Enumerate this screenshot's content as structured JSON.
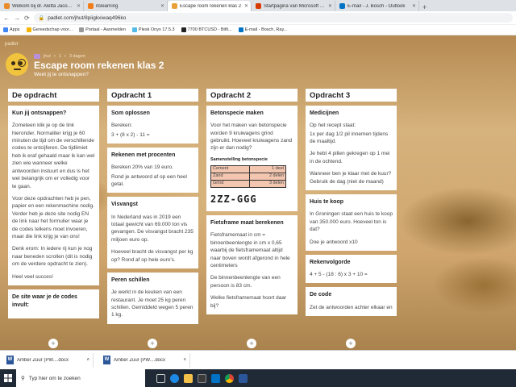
{
  "browser": {
    "tabs": [
      {
        "title": "Welkom bij dr. Aletta Jacobs Coll",
        "color": "#e98b2a"
      },
      {
        "title": "itslearning",
        "color": "#f27d1b"
      },
      {
        "title": "Escape room rekenen klas 2",
        "color": "#e8a13a",
        "active": true
      },
      {
        "title": "Startpagina van Microsoft Office",
        "color": "#d83b01"
      },
      {
        "title": "E-mail - J. Bosch - Outlook",
        "color": "#0072c6"
      }
    ],
    "new_tab": "+",
    "url": "padlet.com/jhut/8piigkxiwaq496ko",
    "bookmarks": [
      "Apps",
      "Gereedschap voor...",
      "Portaal - Aanmelden",
      "Plesk Onyx 17.5.3",
      "7700 BTCUSD - Bitfi...",
      "E-mail - Bosch, Ray..."
    ]
  },
  "padlet": {
    "brand": "padlet",
    "meta": {
      "author": "jhut",
      "likes": "1",
      "age": "3 dagen"
    },
    "title": "Escape room rekenen klas 2",
    "subtitle": "Weet jij te ontsnappen?",
    "add_symbol": "+"
  },
  "columns": [
    {
      "title": "De opdracht",
      "cards": [
        {
          "title": "Kun jij ontsnappen?",
          "paras": [
            "Zometeen klik je op de link hieronder. Normaliter krijg je 60 minuten de tijd om de verschillende codes te ontcijferen. De tijdlimiet heb ik eraf gehaald maar ik kan wel zien wie wanneer welke antwoorden instuurt en dus is het wel belangrijk om er volledig voor te gaan.",
            "Voor deze opdrachten heb je pen, papier en een rekenmachine nodig. Verder heb je deze site nodig EN de link naar het formulier waar je de codes telkens moet invoeren, maar die link krijg je van ons!",
            "Denk erom: In iedere rij kun je nog naar beneden scrollen (dit is nodig om de verdere opdracht te zien).",
            "Heel veel succes!"
          ]
        },
        {
          "title": "De site waar je de codes invult:",
          "paras": []
        }
      ]
    },
    {
      "title": "Opdracht 1",
      "cards": [
        {
          "title": "Som oplossen",
          "paras": [
            "Bereken:",
            "3 + (8 x 2) - 11 ="
          ]
        },
        {
          "title": "Rekenen met procenten",
          "paras": [
            "Bereken 20% van 19 euro.",
            "Rond je antwoord af op een heel getal."
          ]
        },
        {
          "title": "Visvangst",
          "paras": [
            "In Nederland was in 2019 een totaal gewicht van 69.000 ton vis gevangen. De visvangst bracht 235 miljoen euro op.",
            "Hoeveel bracht de visvangst per kg op? Rond af op hele euro's."
          ]
        },
        {
          "title": "Peren schillen",
          "paras": [
            "Je werkt in de keuken van een restaurant. Je moet 25 kg peren schillen. Gemiddeld wegen 5 peren 1 kg."
          ]
        }
      ]
    },
    {
      "title": "Opdracht 2",
      "cards": [
        {
          "title": "Betonspecie maken",
          "paras": [
            "Voor het maken van betonspecie worden 9 kruiwagens grind gebruikt. Hoeveel kruiwagens zand zijn er dan nodig?"
          ],
          "table": {
            "title": "Samenstelling betonspecie",
            "rows": [
              [
                "Cement",
                "1 deel"
              ],
              [
                "Zand",
                "2 delen"
              ],
              [
                "Grind",
                "3 delen"
              ]
            ]
          },
          "figure": "2ZZ-GGG"
        },
        {
          "title": "Fietsframe maat berekenen",
          "paras": [
            "Fietsframemaat in cm = binnenbeenlengte in cm x 0,65 waarbij de fietsframemaat altijd naar boven wordt afgerond in hele centimeters",
            "De binnenbeenlengte van een persoon is 83 cm.",
            "Welke fietsframemaat hoort daar bij?"
          ]
        }
      ]
    },
    {
      "title": "Opdracht 3",
      "cards": [
        {
          "title": "Medicijnen",
          "paras": [
            "Op het recept staat:",
            "1x per dag 1/2 pil innemen tijdens de maaltijd.",
            "Je hebt 4 pillen gekregen op 1 mei in de ochtend.",
            "Wanneer ben je klaar met de kuur? Gebruik de dag (niet de maand)"
          ]
        },
        {
          "title": "Huis te koop",
          "paras": [
            "In Groningen staat een huis te koop van 350.000 euro. Hoeveel ton is dat?",
            "Doe je antwoord x10"
          ]
        },
        {
          "title": "Rekenvolgorde",
          "paras": [
            "4 + 5 - (18 : 6) x 3 + 10 ="
          ]
        },
        {
          "title": "De code",
          "paras": [
            "Zet de antwoorden achter elkaar en"
          ]
        }
      ]
    }
  ],
  "downloads": [
    {
      "name": "Amber Zuur (PW....docx",
      "icon": "W"
    },
    {
      "name": "Amber Zuur (PW....docx",
      "icon": "W"
    }
  ],
  "taskbar": {
    "search_placeholder": "Typ hier om te zoeken"
  }
}
